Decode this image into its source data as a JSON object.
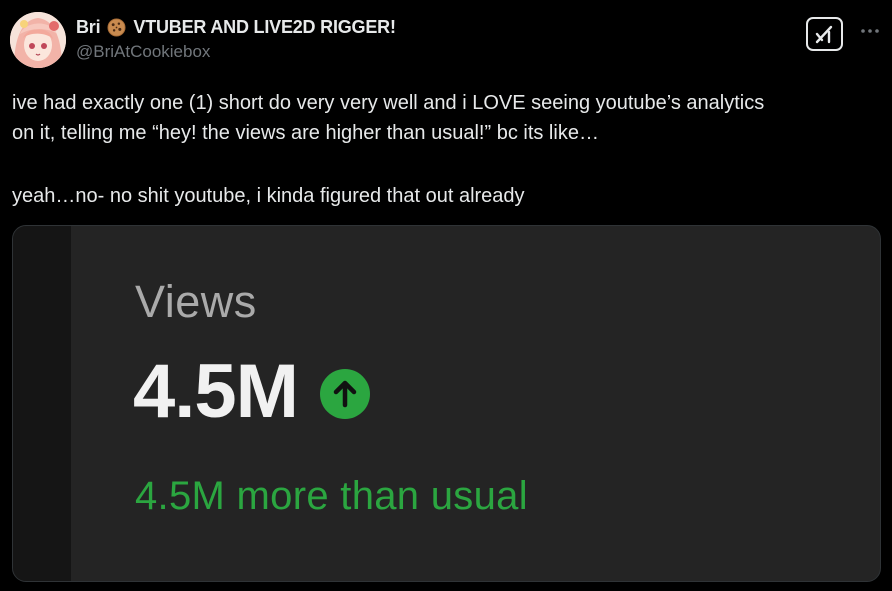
{
  "author": {
    "name": "Bri",
    "name_suffix": "VTUBER AND LIVE2D RIGGER!",
    "name_emoji": "cookie-icon",
    "handle": "@BriAtCookiebox"
  },
  "actions": {
    "grok_icon": "grok-icon",
    "more_icon": "more-dots-icon"
  },
  "tweet": {
    "lines": [
      "ive had exactly one (1) short do very very well and i LOVE seeing youtube’s analytics",
      "on it, telling me “hey! the views are higher than usual!” bc its like…",
      "yeah…no- no shit youtube, i kinda figured that out already"
    ]
  },
  "media": {
    "label": "Views",
    "value": "4.5M",
    "trend_icon": "up-arrow-icon",
    "note": "4.5M more than usual"
  },
  "colors": {
    "background": "#000000",
    "text": "#e7e9ea",
    "muted": "#71767b",
    "media_bg": "#242424",
    "positive_green": "#2ba640"
  }
}
